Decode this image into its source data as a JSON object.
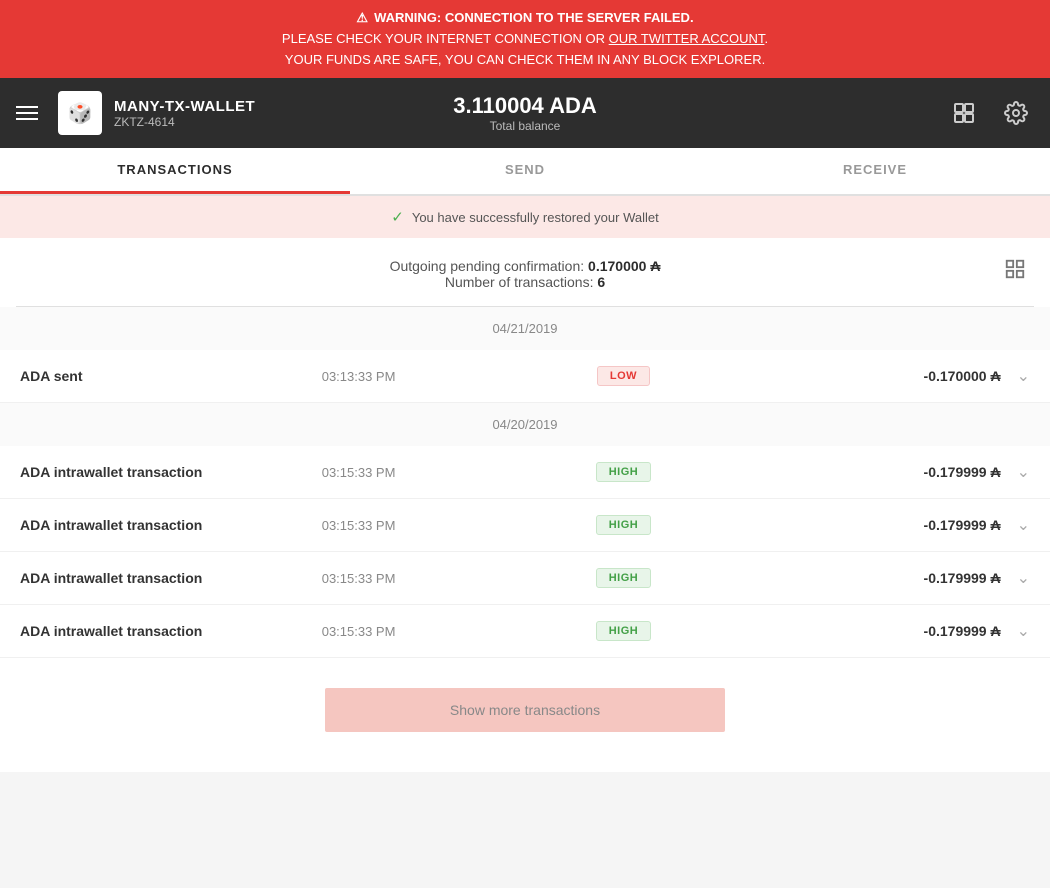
{
  "warning": {
    "icon": "⚠",
    "line1": "WARNING: CONNECTION TO THE SERVER FAILED.",
    "line2_prefix": "PLEASE CHECK YOUR INTERNET CONNECTION OR ",
    "line2_link": "OUR TWITTER ACCOUNT",
    "line2_suffix": ".",
    "line3": "YOUR FUNDS ARE SAFE, YOU CAN CHECK THEM IN ANY BLOCK EXPLORER."
  },
  "header": {
    "wallet_name": "MANY-TX-WALLET",
    "wallet_id": "ZKTZ-4614",
    "wallet_avatar": "🎲",
    "balance_amount": "3.110004 ADA",
    "balance_label": "Total balance"
  },
  "tabs": [
    {
      "label": "TRANSACTIONS",
      "active": true
    },
    {
      "label": "SEND",
      "active": false
    },
    {
      "label": "RECEIVE",
      "active": false
    }
  ],
  "success_message": "You have successfully restored your Wallet",
  "summary": {
    "pending_label": "Outgoing pending confirmation:",
    "pending_amount": "0.170000",
    "tx_count_label": "Number of transactions:",
    "tx_count": "6"
  },
  "date_groups": [
    {
      "date": "04/21/2019",
      "transactions": [
        {
          "title": "ADA sent",
          "time": "03:13:33 PM",
          "badge": "LOW",
          "badge_type": "low",
          "amount": "-0.170000 ₳"
        }
      ]
    },
    {
      "date": "04/20/2019",
      "transactions": [
        {
          "title": "ADA intrawallet transaction",
          "time": "03:15:33 PM",
          "badge": "HIGH",
          "badge_type": "high",
          "amount": "-0.179999 ₳"
        },
        {
          "title": "ADA intrawallet transaction",
          "time": "03:15:33 PM",
          "badge": "HIGH",
          "badge_type": "high",
          "amount": "-0.179999 ₳"
        },
        {
          "title": "ADA intrawallet transaction",
          "time": "03:15:33 PM",
          "badge": "HIGH",
          "badge_type": "high",
          "amount": "-0.179999 ₳"
        },
        {
          "title": "ADA intrawallet transaction",
          "time": "03:15:33 PM",
          "badge": "HIGH",
          "badge_type": "high",
          "amount": "-0.179999 ₳"
        }
      ]
    }
  ],
  "show_more_label": "Show more transactions"
}
